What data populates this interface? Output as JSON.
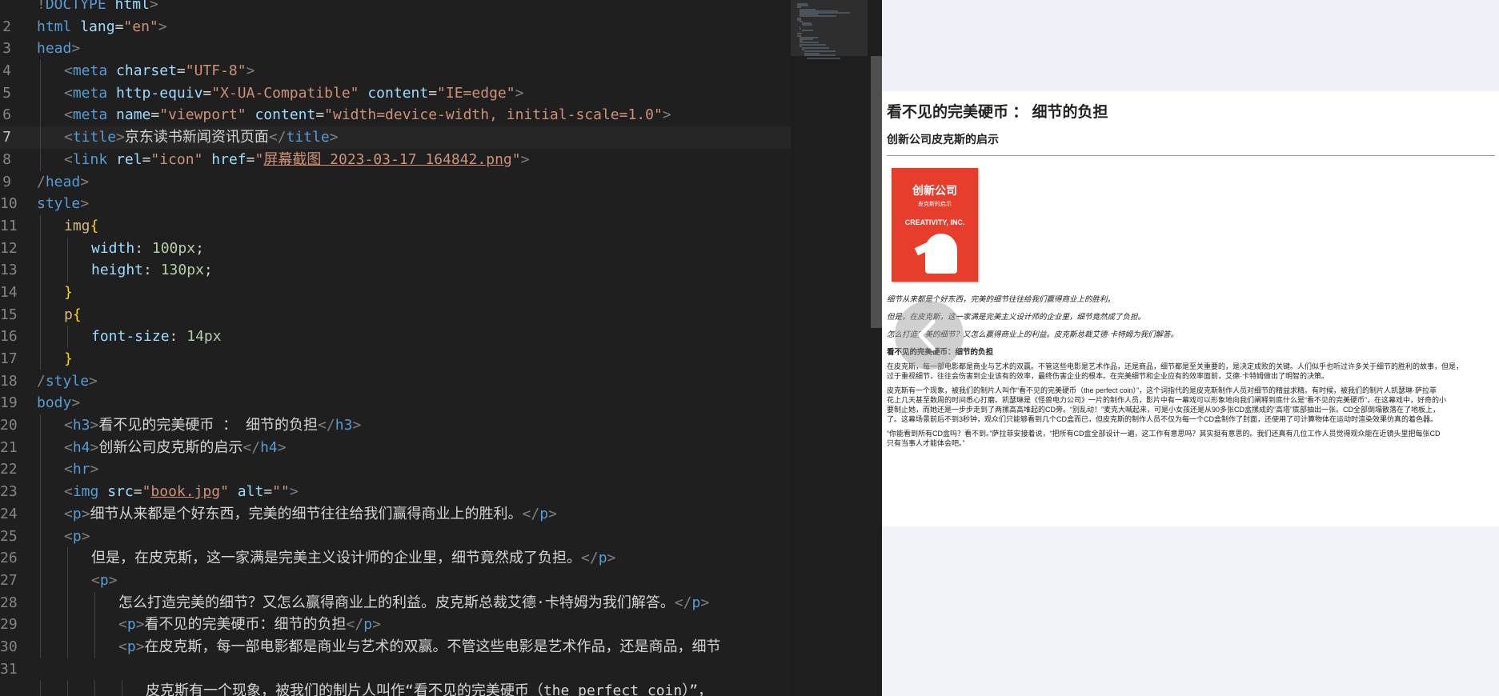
{
  "editor": {
    "active_line": 7,
    "code_lines": [
      {
        "n": "",
        "indent": 0,
        "tokens": [
          [
            "punct",
            "!"
          ],
          [
            "tag",
            "DOCTYPE"
          ],
          [
            "ws",
            " "
          ],
          [
            "attr",
            "html"
          ],
          [
            "punct",
            ">"
          ]
        ]
      },
      {
        "n": "2",
        "indent": 0,
        "tokens": [
          [
            "tag",
            "html"
          ],
          [
            "ws",
            " "
          ],
          [
            "attr",
            "lang"
          ],
          [
            "eq",
            "="
          ],
          [
            "str",
            "\"en\""
          ],
          [
            "punct",
            ">"
          ]
        ]
      },
      {
        "n": "3",
        "indent": 0,
        "tokens": [
          [
            "tag",
            "head"
          ],
          [
            "punct",
            ">"
          ]
        ]
      },
      {
        "n": "4",
        "indent": 1,
        "tokens": [
          [
            "punct",
            "<"
          ],
          [
            "tag",
            "meta"
          ],
          [
            "ws",
            " "
          ],
          [
            "attr",
            "charset"
          ],
          [
            "eq",
            "="
          ],
          [
            "str",
            "\"UTF-8\""
          ],
          [
            "punct",
            ">"
          ]
        ]
      },
      {
        "n": "5",
        "indent": 1,
        "tokens": [
          [
            "punct",
            "<"
          ],
          [
            "tag",
            "meta"
          ],
          [
            "ws",
            " "
          ],
          [
            "attr",
            "http-equiv"
          ],
          [
            "eq",
            "="
          ],
          [
            "str",
            "\"X-UA-Compatible\""
          ],
          [
            "ws",
            " "
          ],
          [
            "attr",
            "content"
          ],
          [
            "eq",
            "="
          ],
          [
            "str",
            "\"IE=edge\""
          ],
          [
            "punct",
            ">"
          ]
        ]
      },
      {
        "n": "6",
        "indent": 1,
        "tokens": [
          [
            "punct",
            "<"
          ],
          [
            "tag",
            "meta"
          ],
          [
            "ws",
            " "
          ],
          [
            "attr",
            "name"
          ],
          [
            "eq",
            "="
          ],
          [
            "str",
            "\"viewport\""
          ],
          [
            "ws",
            " "
          ],
          [
            "attr",
            "content"
          ],
          [
            "eq",
            "="
          ],
          [
            "str",
            "\"width=device-width, initial-scale=1.0\""
          ],
          [
            "punct",
            ">"
          ]
        ]
      },
      {
        "n": "7",
        "indent": 1,
        "tokens": [
          [
            "punct",
            "<"
          ],
          [
            "tag",
            "title"
          ],
          [
            "punct",
            ">"
          ],
          [
            "text",
            "京东读书新闻资讯页面"
          ],
          [
            "punct",
            "</"
          ],
          [
            "tag",
            "title"
          ],
          [
            "punct",
            ">"
          ]
        ]
      },
      {
        "n": "8",
        "indent": 1,
        "tokens": [
          [
            "punct",
            "<"
          ],
          [
            "tag",
            "link"
          ],
          [
            "ws",
            " "
          ],
          [
            "attr",
            "rel"
          ],
          [
            "eq",
            "="
          ],
          [
            "str",
            "\"icon\""
          ],
          [
            "ws",
            " "
          ],
          [
            "attr",
            "href"
          ],
          [
            "eq",
            "="
          ],
          [
            "str",
            "\""
          ],
          [
            "link",
            "屏幕截图 2023-03-17 164842.png"
          ],
          [
            "str",
            "\""
          ],
          [
            "punct",
            ">"
          ]
        ]
      },
      {
        "n": "9",
        "indent": 0,
        "tokens": [
          [
            "punct",
            "/"
          ],
          [
            "tag",
            "head"
          ],
          [
            "punct",
            ">"
          ]
        ]
      },
      {
        "n": "10",
        "indent": 0,
        "tokens": [
          [
            "tag",
            "style"
          ],
          [
            "punct",
            ">"
          ]
        ]
      },
      {
        "n": "11",
        "indent": 1,
        "tokens": [
          [
            "sel",
            "img"
          ],
          [
            "brace",
            "{"
          ]
        ]
      },
      {
        "n": "12",
        "indent": 2,
        "tokens": [
          [
            "prop",
            "width"
          ],
          [
            "eq",
            ": "
          ],
          [
            "num",
            "100px"
          ],
          [
            "eq",
            ";"
          ]
        ]
      },
      {
        "n": "13",
        "indent": 2,
        "tokens": [
          [
            "prop",
            "height"
          ],
          [
            "eq",
            ": "
          ],
          [
            "num",
            "130px"
          ],
          [
            "eq",
            ";"
          ]
        ]
      },
      {
        "n": "14",
        "indent": 1,
        "tokens": [
          [
            "brace",
            "}"
          ]
        ]
      },
      {
        "n": "15",
        "indent": 1,
        "tokens": [
          [
            "sel",
            "p"
          ],
          [
            "brace",
            "{"
          ]
        ]
      },
      {
        "n": "16",
        "indent": 2,
        "tokens": [
          [
            "prop",
            "font-size"
          ],
          [
            "eq",
            ": "
          ],
          [
            "num",
            "14px"
          ]
        ]
      },
      {
        "n": "17",
        "indent": 1,
        "tokens": [
          [
            "brace",
            "}"
          ]
        ]
      },
      {
        "n": "18",
        "indent": 0,
        "tokens": [
          [
            "punct",
            "/"
          ],
          [
            "tag",
            "style"
          ],
          [
            "punct",
            ">"
          ]
        ]
      },
      {
        "n": "19",
        "indent": 0,
        "tokens": [
          [
            "tag",
            "body"
          ],
          [
            "punct",
            ">"
          ]
        ]
      },
      {
        "n": "20",
        "indent": 1,
        "tokens": [
          [
            "punct",
            "<"
          ],
          [
            "tag",
            "h3"
          ],
          [
            "punct",
            ">"
          ],
          [
            "text",
            "看不见的完美硬币 ： 细节的负担"
          ],
          [
            "punct",
            "</"
          ],
          [
            "tag",
            "h3"
          ],
          [
            "punct",
            ">"
          ]
        ]
      },
      {
        "n": "21",
        "indent": 1,
        "tokens": [
          [
            "punct",
            "<"
          ],
          [
            "tag",
            "h4"
          ],
          [
            "punct",
            ">"
          ],
          [
            "text",
            "创新公司皮克斯的启示"
          ],
          [
            "punct",
            "</"
          ],
          [
            "tag",
            "h4"
          ],
          [
            "punct",
            ">"
          ]
        ]
      },
      {
        "n": "22",
        "indent": 1,
        "tokens": [
          [
            "punct",
            "<"
          ],
          [
            "tag",
            "hr"
          ],
          [
            "punct",
            ">"
          ]
        ]
      },
      {
        "n": "23",
        "indent": 1,
        "tokens": [
          [
            "punct",
            "<"
          ],
          [
            "tag",
            "img"
          ],
          [
            "ws",
            " "
          ],
          [
            "attr",
            "src"
          ],
          [
            "eq",
            "="
          ],
          [
            "str",
            "\""
          ],
          [
            "link",
            "book.jpg"
          ],
          [
            "str",
            "\""
          ],
          [
            "ws",
            " "
          ],
          [
            "attr",
            "alt"
          ],
          [
            "eq",
            "="
          ],
          [
            "str",
            "\"\""
          ],
          [
            "punct",
            ">"
          ]
        ]
      },
      {
        "n": "24",
        "indent": 1,
        "tokens": [
          [
            "punct",
            "<"
          ],
          [
            "tag",
            "p"
          ],
          [
            "punct",
            ">"
          ],
          [
            "text",
            "细节从来都是个好东西，完美的细节往往给我们赢得商业上的胜利。"
          ],
          [
            "punct",
            "</"
          ],
          [
            "tag",
            "p"
          ],
          [
            "punct",
            ">"
          ]
        ]
      },
      {
        "n": "25",
        "indent": 1,
        "tokens": [
          [
            "punct",
            "<"
          ],
          [
            "tag",
            "p"
          ],
          [
            "punct",
            ">"
          ]
        ]
      },
      {
        "n": "26",
        "indent": 2,
        "tokens": [
          [
            "text",
            "但是，在皮克斯，这一家满是完美主义设计师的企业里，细节竟然成了负担。"
          ],
          [
            "punct",
            "</"
          ],
          [
            "tag",
            "p"
          ],
          [
            "punct",
            ">"
          ]
        ]
      },
      {
        "n": "27",
        "indent": 2,
        "tokens": [
          [
            "punct",
            "<"
          ],
          [
            "tag",
            "p"
          ],
          [
            "punct",
            ">"
          ]
        ]
      },
      {
        "n": "28",
        "indent": 3,
        "tokens": [
          [
            "text",
            "怎么打造完美的细节？又怎么赢得商业上的利益。皮克斯总裁艾德·卡特姆为我们解答。"
          ],
          [
            "punct",
            "</"
          ],
          [
            "tag",
            "p"
          ],
          [
            "punct",
            ">"
          ]
        ]
      },
      {
        "n": "29",
        "indent": 3,
        "tokens": [
          [
            "punct",
            "<"
          ],
          [
            "tag",
            "p"
          ],
          [
            "punct",
            ">"
          ],
          [
            "text",
            "看不见的完美硬币：细节的负担"
          ],
          [
            "punct",
            "</"
          ],
          [
            "tag",
            "p"
          ],
          [
            "punct",
            ">"
          ]
        ]
      },
      {
        "n": "30",
        "indent": 3,
        "tokens": [
          [
            "punct",
            "<"
          ],
          [
            "tag",
            "p"
          ],
          [
            "punct",
            ">"
          ],
          [
            "text",
            "在皮克斯，每一部电影都是商业与艺术的双赢。不管这些电影是艺术作品，还是商品，细节"
          ]
        ]
      },
      {
        "n": "31",
        "indent": 0,
        "tokens": []
      },
      {
        "n": "",
        "indent": 4,
        "tokens": [
          [
            "text",
            "皮克斯有一个现象，被我们的制片人叫作“看不见的完美硬币（the perfect coin）”，"
          ]
        ]
      }
    ]
  },
  "preview": {
    "h3": "看不见的完美硬币 ： 细节的负担",
    "h4": "创新公司皮克斯的启示",
    "book": {
      "title": "创新公司",
      "subtitle": "皮克斯的启示",
      "english": "CREATIVITY, INC."
    },
    "p1": "细节从来都是个好东西，完美的细节往往给我们赢得商业上的胜利。",
    "p2": "但是，在皮克斯，这一家满是完美主义设计师的企业里，细节竟然成了负担。",
    "p3": "怎么打造完美的细节？又怎么赢得商业上的利益。皮克斯总裁艾德·卡特姆为我们解答。",
    "p4": "看不见的完美硬币：细节的负担",
    "p5a": "在皮克斯，每一部电影都是商业与艺术的双赢。不管这些电影是艺术作品，还是商品，细节都是至关重要的，是决定成败的关键。人们似乎也听过许多关于细节的胜利的故事，但是，",
    "p5b": "过于重视细节，往往会伤害到企业该有的效率，最终伤害企业的根本。在完美细节和企业应有的效率面前，艾德·卡特姆做出了明智的决策。",
    "p6a": "皮克斯有一个现象，被我们的制片人叫作“看不见的完美硬币（the perfect coin）”，这个词指代的是皮克斯制作人员对细节的精益求精。有时候，被我们的制片人凯瑟琳·萨拉菲",
    "p6b": "花上几天甚至数周的时间悉心打磨。凯瑟琳是《怪兽电力公司》一片的制作人员，影片中有一幕戏可以形象地向我们阐释到底什么是“看不见的完美硬币”，在这幕戏中，好奇的小",
    "p6c": "要制止她，而她还是一步步走到了两摞高高堆起的CD旁。“别乱动！”麦克大喊起来，可是小女孩还是从90多张CD盒摞成的“高塔”底部抽出一张。CD全部倒塌散落在了地板上，",
    "p6d": "了。这幕场景前后不到3秒钟，观众们只能够看到几个CD盒而已，但皮克斯的制作人员不仅为每一个CD盒制作了封面，还使用了可计算物体在运动时渲染效果仿真的着色器。",
    "p7a": "“你能看到所有CD盒吗？看不到。”萨拉菲安接着说，“把所有CD盒全部设计一遍，这工作有意思吗？其实挺有意思的。我们还真有几位工作人员觉得观众能在近镜头里把每张CD",
    "p7b": "只有当事人才能体会吧。”"
  },
  "icons": {
    "back": "back-arrow-icon"
  }
}
